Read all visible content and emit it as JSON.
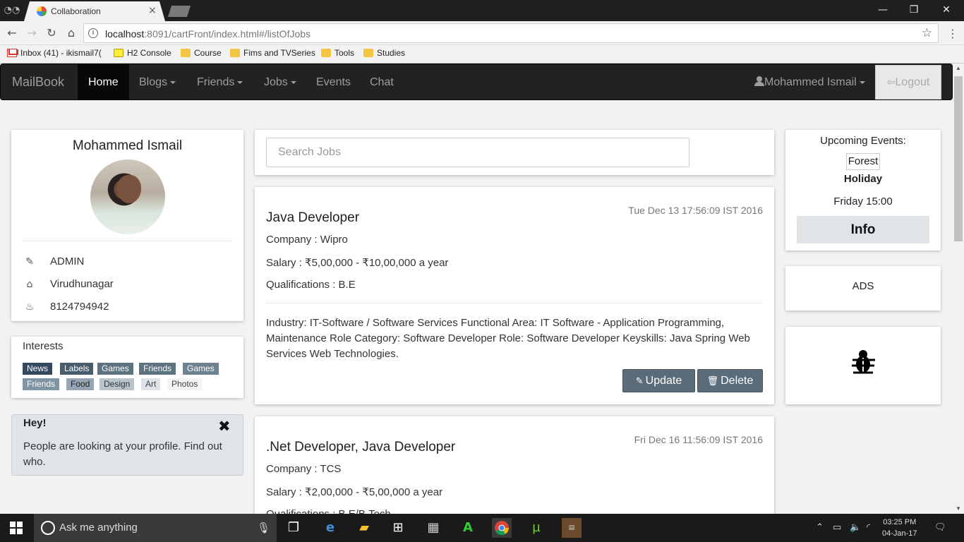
{
  "browser": {
    "tab_title": "Collaboration",
    "tab_close": "×",
    "url_host": "localhost",
    "url_rest": ":8091/cartFront/index.html#/listOfJobs",
    "bookmarks": [
      {
        "label": "Inbox (41) - ikismail7(",
        "icon": "gmail-icon"
      },
      {
        "label": "H2 Console",
        "icon": "h2-icon"
      },
      {
        "label": "Course",
        "icon": "folder-icon"
      },
      {
        "label": "Fims and TVSeries",
        "icon": "folder-icon"
      },
      {
        "label": "Tools",
        "icon": "folder-icon"
      },
      {
        "label": "Studies",
        "icon": "folder-icon"
      }
    ]
  },
  "navbar": {
    "brand": "MailBook",
    "items": [
      "Home",
      "Blogs",
      "Friends",
      "Jobs",
      "Events",
      "Chat"
    ],
    "user": "Mohammed Ismail",
    "logout": "Logout"
  },
  "profile": {
    "name": "Mohammed Ismail",
    "role": "ADMIN",
    "location": "Virudhunagar",
    "phone": "8124794942"
  },
  "interests": {
    "title": "Interests",
    "tags": [
      "News",
      "Labels",
      "Games",
      "Friends",
      "Games",
      "Friends",
      "Food",
      "Design",
      "Art",
      "Photos"
    ]
  },
  "alert": {
    "heading": "Hey!",
    "message": "People are looking at your profile. Find out who."
  },
  "search": {
    "placeholder": "Search Jobs"
  },
  "jobs": [
    {
      "title": "Java Developer",
      "date": "Tue Dec 13 17:56:09 IST 2016",
      "company": "Company : Wipro",
      "salary": "Salary : ₹5,00,000 - ₹10,00,000 a year",
      "qualifications": "Qualifications : B.E",
      "description": "Industry: IT-Software / Software Services Functional Area: IT Software - Application Programming, Maintenance Role Category: Software Developer Role: Software Developer Keyskills: Java Spring Web Services Web Technologies.",
      "update_label": "Update",
      "delete_label": "Delete"
    },
    {
      "title": ".Net Developer, Java Developer",
      "date": "Fri Dec 16 11:56:09 IST 2016",
      "company": "Company : TCS",
      "salary": "Salary : ₹2,00,000 - ₹5,00,000 a year",
      "qualifications": "Qualifications : B.E/B.Tech"
    }
  ],
  "events": {
    "heading": "Upcoming Events:",
    "name_line1": "Forest",
    "name_line2": "Holiday",
    "time": "Friday 15:00",
    "info": "Info"
  },
  "ads": {
    "label": "ADS"
  },
  "taskbar": {
    "search_placeholder": "Ask me anything",
    "time": "03:25 PM",
    "date": "04-Jan-17"
  },
  "colors": {
    "navbar_bg": "#222222",
    "tag_dark": "#34495e",
    "tag_mid": "#5d7380",
    "tag_light": "#95a5b3",
    "button": "#5a6b79"
  }
}
